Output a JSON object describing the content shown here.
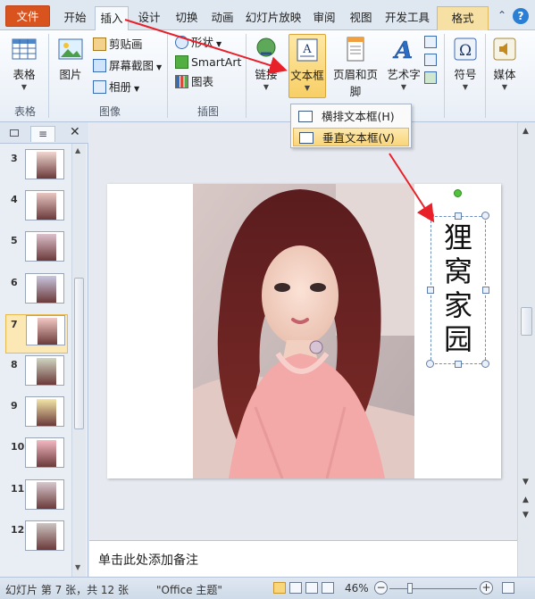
{
  "tabs": {
    "file": "文件",
    "home": "开始",
    "insert": "插入",
    "design": "设计",
    "transitions": "切换",
    "animations": "动画",
    "slideshow": "幻灯片放映",
    "review": "审阅",
    "view": "视图",
    "developer": "开发工具",
    "format": "格式"
  },
  "ribbon": {
    "table": "表格",
    "picture": "图片",
    "clipart": "剪贴画",
    "screenshot": "屏幕截图",
    "album": "相册",
    "shapes": "形状",
    "smartart": "SmartArt",
    "chart": "图表",
    "link": "链接",
    "textbox": "文本框",
    "header_footer": "页眉和页脚",
    "wordart": "艺术字",
    "symbol": "符号",
    "media": "媒体",
    "groups": {
      "tables": "表格",
      "images": "图像",
      "illustrations": "插图"
    }
  },
  "dropdown": {
    "horizontal": "横排文本框(H)",
    "vertical": "垂直文本框(V)"
  },
  "slides": [
    {
      "num": "3"
    },
    {
      "num": "4"
    },
    {
      "num": "5"
    },
    {
      "num": "6"
    },
    {
      "num": "7"
    },
    {
      "num": "8"
    },
    {
      "num": "9"
    },
    {
      "num": "10"
    },
    {
      "num": "11"
    },
    {
      "num": "12"
    }
  ],
  "slide": {
    "vertical_text": "狸窝家园"
  },
  "notes": {
    "placeholder": "单击此处添加备注"
  },
  "status": {
    "slide_info": "幻灯片 第 7 张，共 12 张",
    "theme": "\"Office 主题\"",
    "zoom": "46%",
    "zoom_level": 0.46
  },
  "colors": {
    "file_tab": "#d9531e",
    "highlight": "#f9d67a",
    "arrow": "#e8202a",
    "handle_green": "#52c23c"
  }
}
